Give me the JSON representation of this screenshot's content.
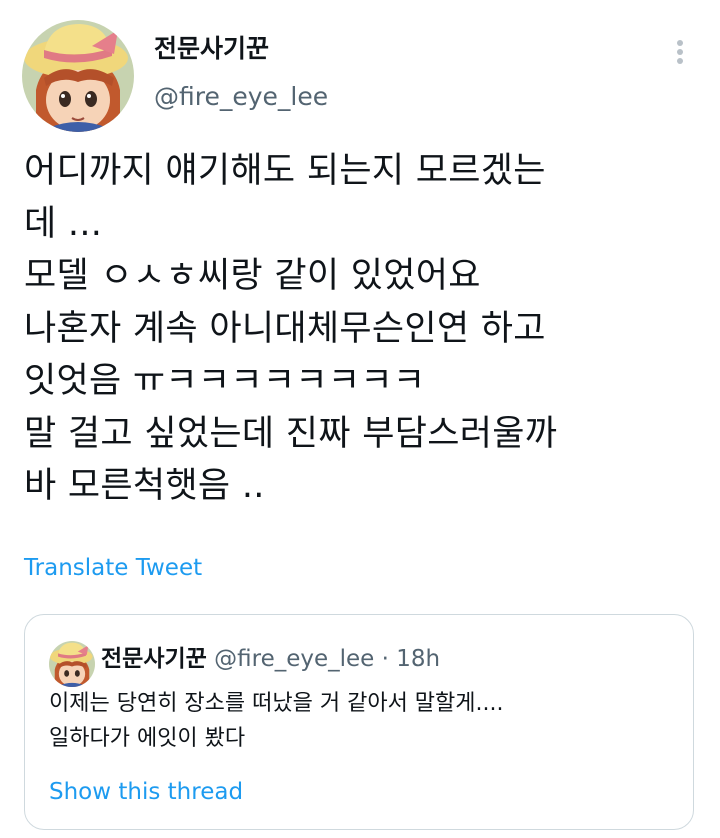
{
  "author": {
    "name": "전문사기꾼",
    "handle": "@fire_eye_lee"
  },
  "tweet": {
    "lines": [
      "어디까지 얘기해도 되는지 모르겠는",
      "데 ...",
      "모델 ㅇㅅㅎ씨랑 같이 있었어요",
      "나혼자 계속 아니대체무슨인연 하고",
      "잇엇음 ㅠㅋㅋㅋㅋㅋㅋㅋㅋ",
      "말 걸고 싶었는데 진짜 부담스러울까",
      "바 모른척햇음 .."
    ]
  },
  "translate_label": "Translate Tweet",
  "quote": {
    "name": "전문사기꾼",
    "handle": "@fire_eye_lee",
    "separator": "·",
    "time": "18h",
    "lines": [
      "이제는 당연히 장소를 떠났을 거 같아서 말할게....",
      "일하다가 에잇이 봤다"
    ],
    "thread_label": "Show this thread"
  },
  "colors": {
    "text": "#0f1419",
    "secondary": "#536471",
    "link": "#1d9bf0",
    "border": "#cfd9de"
  },
  "icons": {
    "more": "more-options-icon",
    "avatar": "anime-girl-straw-hat"
  }
}
